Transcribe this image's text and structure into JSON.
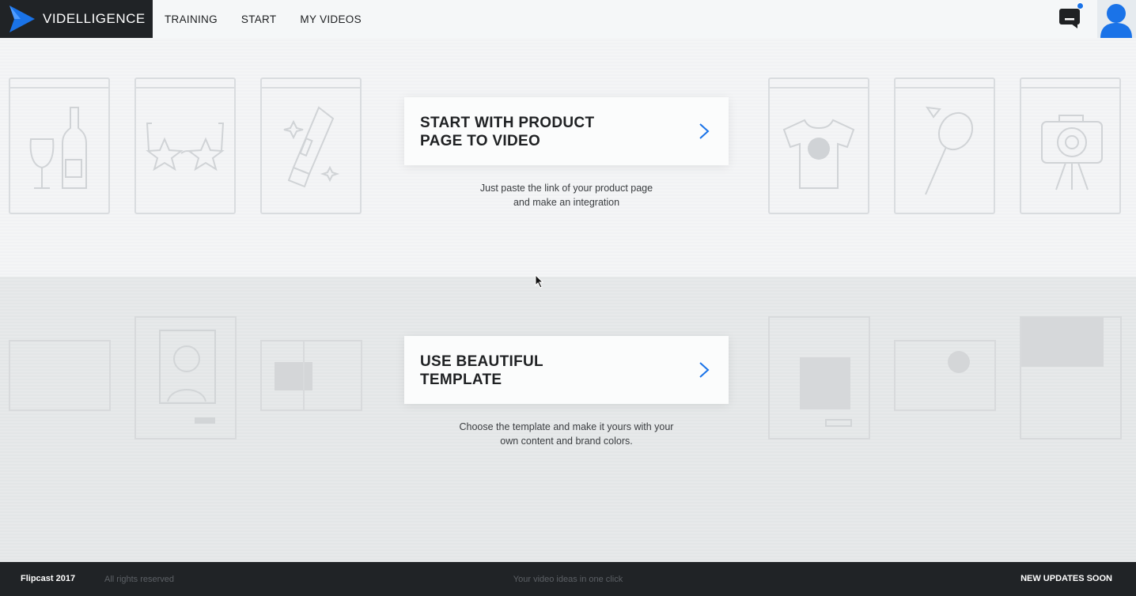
{
  "brand": {
    "name": "VIDELLIGENCE",
    "accent": "#1a73e8",
    "bar_color": "#202326"
  },
  "nav": {
    "items": [
      "TRAINING",
      "START",
      "MY VIDEOS"
    ]
  },
  "header_icons": {
    "chat": "chat-icon",
    "user": "user-avatar-icon"
  },
  "options": [
    {
      "title_line1": "START WITH PRODUCT",
      "title_line2": "PAGE TO VIDEO",
      "desc_line1": "Just paste the link of your product page",
      "desc_line2": "and make an integration"
    },
    {
      "title_line1": "USE BEAUTIFUL",
      "title_line2": "TEMPLATE",
      "desc_line1": "Choose the template and make it yours with your",
      "desc_line2": "own content and brand colors."
    }
  ],
  "footer": {
    "copyright": "Flipcast 2017",
    "rights": "All rights reserved",
    "tagline": "Your video ideas in one click",
    "updates": "NEW UPDATES SOON"
  }
}
